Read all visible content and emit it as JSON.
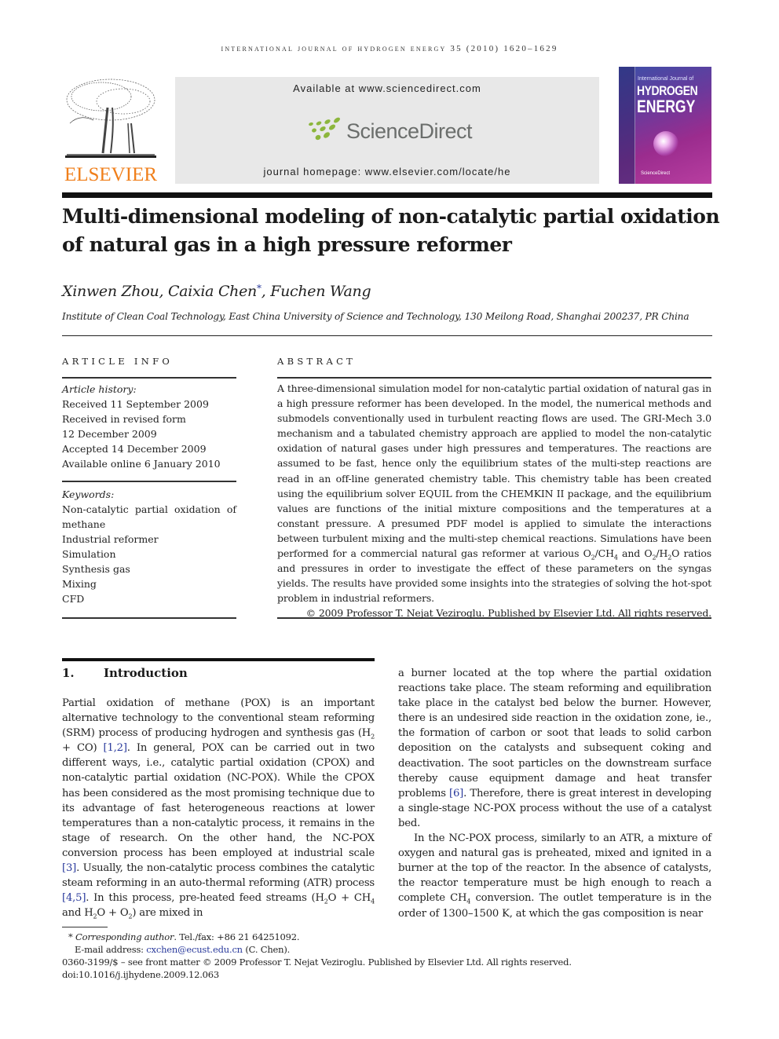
{
  "running_header": "INTERNATIONAL JOURNAL OF HYDROGEN ENERGY 35 (2010) 1620–1629",
  "masthead": {
    "publisher_logo": "ELSEVIER",
    "available_at": "Available at www.sciencedirect.com",
    "sciencedirect_logo": "ScienceDirect",
    "journal_homepage": "journal homepage: www.elsevier.com/locate/he",
    "cover": {
      "line1": "International Journal of",
      "line2": "HYDROGEN",
      "line3": "ENERGY",
      "footer": "ScienceDirect"
    },
    "colors": {
      "elsevier_orange": "#f07f1b",
      "sciencedirect_green": "#8cb63c",
      "box_gray": "#e8e8e8"
    }
  },
  "article": {
    "title": "Multi-dimensional modeling of non-catalytic partial oxidation of natural gas in a high pressure reformer",
    "authors": [
      {
        "name": "Xinwen Zhou",
        "mark": ""
      },
      {
        "name": "Caixia Chen",
        "mark": "*"
      },
      {
        "name": "Fuchen Wang",
        "mark": ""
      }
    ],
    "author_sep": ", ",
    "affiliation": "Institute of Clean Coal Technology, East China University of Science and Technology, 130 Meilong Road, Shanghai 200237, PR China"
  },
  "article_info": {
    "heading": "ARTICLE INFO",
    "history_label": "Article history:",
    "history": [
      "Received 11 September 2009",
      "Received in revised form",
      "12 December 2009",
      "Accepted 14 December 2009",
      "Available online 6 January 2010"
    ],
    "keywords_label": "Keywords:",
    "keywords": [
      "Non-catalytic partial oxidation of methane",
      "Industrial reformer",
      "Simulation",
      "Synthesis gas",
      "Mixing",
      "CFD"
    ]
  },
  "abstract": {
    "heading": "ABSTRACT",
    "text_a": "A three-dimensional simulation model for non-catalytic partial oxidation of natural gas in a high pressure reformer has been developed. In the model, the numerical methods and submodels conventionally used in turbulent reacting flows are used. The GRI-Mech 3.0 mechanism and a tabulated chemistry approach are applied to model the non-catalytic oxidation of natural gases under high pressures and temperatures. The reactions are assumed to be fast, hence only the equilibrium states of the multi-step reactions are read in an off-line generated chemistry table. This chemistry table has been created using the equilibrium solver EQUIL from the CHEMKIN II package, and the equilibrium values are functions of the initial mixture compositions and the temperatures at a constant pressure. A presumed PDF model is applied to simulate the interactions between turbulent mixing and the multi-step chemical reactions. Simulations have been performed for a commercial natural gas reformer at various O",
    "text_b": "/CH",
    "text_c": " and O",
    "text_d": "/H",
    "text_e": "O ratios and pressures in order to investigate the effect of these parameters on the syngas yields. The results have provided some insights into the strategies of solving the hot-spot problem in industrial reformers.",
    "copyright": "© 2009 Professor T. Nejat Veziroglu. Published by Elsevier Ltd. All rights reserved."
  },
  "section": {
    "number": "1.",
    "title": "Introduction"
  },
  "body": {
    "left": {
      "s1": "Partial oxidation of methane (POX) is an important alternative technology to the conventional steam reforming (SRM) process of producing hydrogen and synthesis gas (H",
      "s1b": " + CO) ",
      "ref1": "[1,2]",
      "s2": ". In general, POX can be carried out in two different ways, i.e., catalytic partial oxidation (CPOX) and non-catalytic partial oxidation (NC-POX). While the CPOX has been considered as the most promising technique due to its advantage of fast heterogeneous reactions at lower temperatures than a non-catalytic process, it remains in the stage of research. On the other hand, the NC-POX conversion process has been employed at industrial scale ",
      "ref2": "[3]",
      "s3": ". Usually, the non-catalytic process combines the catalytic steam reforming in an auto-thermal reforming (ATR) process ",
      "ref3": "[4,5]",
      "s4": ". In this process, pre-heated feed streams (H",
      "s5": "O + CH",
      "s6": " and H",
      "s7": "O + O",
      "s8": ") are mixed in"
    },
    "right": {
      "p1a": "a burner located at the top where the partial oxidation reactions take place. The steam reforming and equilibration take place in the catalyst bed below the burner. However, there is an undesired side reaction in the oxidation zone, ie., the formation of carbon or soot that leads to solid carbon deposition on the catalysts and subsequent coking and deactivation. The soot particles on the downstream surface thereby cause equipment damage and heat transfer problems ",
      "ref4": "[6]",
      "p1b": ". Therefore, there is great interest in developing a single-stage NC-POX process without the use of a catalyst bed.",
      "p2a": "In the NC-POX process, similarly to an ATR, a mixture of oxygen and natural gas is preheated, mixed and ignited in a burner at the top of the reactor. In the absence of catalysts, the reactor temperature must be high enough to reach a complete CH",
      "p2b": " conversion. The outlet temperature is in the order of 1300–1500 K, at which the gas composition is near"
    },
    "subscripts": {
      "two": "2",
      "four": "4"
    }
  },
  "footnotes": {
    "star": "*",
    "corr_label": "Corresponding author",
    "corr_text": ". Tel./fax: +86 21 64251092.",
    "email_label": "E-mail address: ",
    "email": "cxchen@ecust.edu.cn",
    "email_suffix": " (C. Chen).",
    "issn": "0360-3199/$ – see front matter © 2009 Professor T. Nejat Veziroglu. Published by Elsevier Ltd. All rights reserved.",
    "doi": "doi:10.1016/j.ijhydene.2009.12.063"
  }
}
